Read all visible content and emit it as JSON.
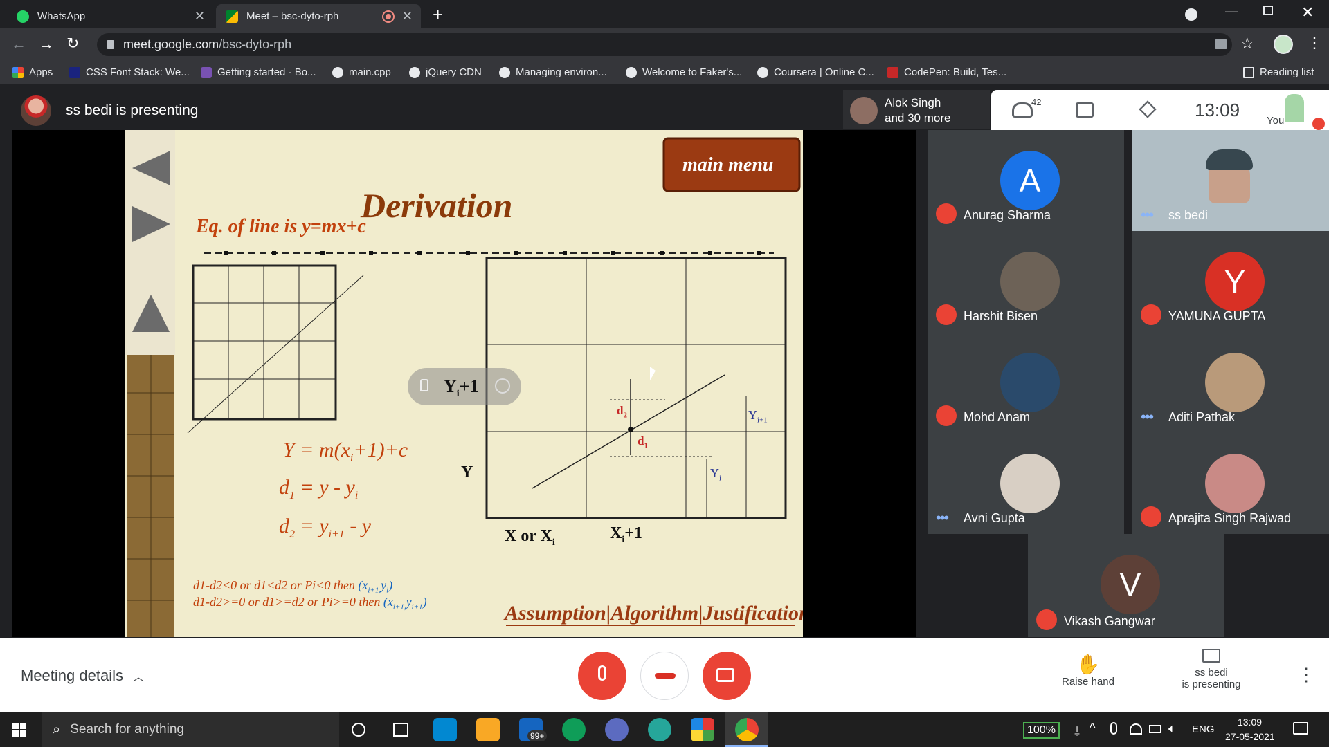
{
  "browser": {
    "tabs": [
      {
        "title": "WhatsApp",
        "active": false,
        "icon": "whatsapp-icon"
      },
      {
        "title": "Meet – bsc-dyto-rph",
        "active": true,
        "icon": "meet-icon",
        "recording": true
      }
    ],
    "url_host": "meet.google.com",
    "url_path": "/bsc-dyto-rph",
    "bookmarks": [
      {
        "label": "Apps",
        "icon": "apps-grid-icon"
      },
      {
        "label": "CSS Font Stack: We...",
        "icon": "cssfont-icon"
      },
      {
        "label": "Getting started · Bo...",
        "icon": "bootstrap-icon"
      },
      {
        "label": "main.cpp",
        "icon": "globe-icon"
      },
      {
        "label": "jQuery CDN",
        "icon": "globe-icon"
      },
      {
        "label": "Managing environ...",
        "icon": "globe-icon"
      },
      {
        "label": "Welcome to Faker's...",
        "icon": "globe-icon"
      },
      {
        "label": "Coursera | Online C...",
        "icon": "globe-icon"
      },
      {
        "label": "CodePen: Build, Tes...",
        "icon": "codepen-icon"
      }
    ],
    "reading_list": "Reading list"
  },
  "meet": {
    "presenter_banner": "ss bedi is presenting",
    "others_name": "Alok Singh",
    "others_more": "and 30 more",
    "participant_count": "42",
    "clock": "13:09",
    "you_label": "You",
    "participants": [
      {
        "name": "Anurag Sharma",
        "initial": "A",
        "color": "#1a73e8",
        "muted": true
      },
      {
        "name": "ss bedi",
        "initial": "",
        "color": "#9aa3ad",
        "muted": false,
        "video": true
      },
      {
        "name": "Harshit Bisen",
        "initial": "",
        "color": "#6d6257",
        "muted": true
      },
      {
        "name": "YAMUNA GUPTA",
        "initial": "Y",
        "color": "#d93025",
        "muted": true
      },
      {
        "name": "Mohd Anam",
        "initial": "",
        "color": "#2a4a6b",
        "muted": true
      },
      {
        "name": "Aditi Pathak",
        "initial": "",
        "color": "#b99a7a",
        "muted": false
      },
      {
        "name": "Avni Gupta",
        "initial": "",
        "color": "#d8cfc4",
        "muted": false
      },
      {
        "name": "Aprajita Singh Rajwad",
        "initial": "",
        "color": "#c98a86",
        "muted": true
      },
      {
        "name": "Vikash Gangwar",
        "initial": "V",
        "color": "#5d4037",
        "muted": true
      }
    ],
    "meeting_details": "Meeting details",
    "raise_hand": "Raise hand",
    "presenting_line1": "ss bedi",
    "presenting_line2": "is presenting"
  },
  "slide": {
    "title": "Derivation",
    "menu_label": "main menu",
    "equation": "Eq. of line is y=mx+c",
    "formula1_main": "Y = m(x",
    "formula1_sub": "i",
    "formula1_tail": "+1)+c",
    "formula2_main": "d",
    "formula2_sub": "1",
    "formula2_tail": " = y - y",
    "formula2_sub2": "i",
    "formula3_main": "d",
    "formula3_sub": "2",
    "formula3_tail": " = y",
    "formula3_sub2": "i+1",
    "formula3_end": " - y",
    "y_label": "Y",
    "x_label_a": "X or X",
    "x_label_a_sub": "i",
    "x_label_b": "X",
    "x_label_b_sub": "i",
    "x_label_b_tail": "+1",
    "d1": "d",
    "d1_sub": "1",
    "d2": "d",
    "d2_sub": "2",
    "yi": "Y",
    "yi_sub": "i",
    "yi1": "Y",
    "yi1_sub": "i+1",
    "popup_label": "Y",
    "popup_sub": "i",
    "popup_tail": "+1",
    "rule1_text": "d1-d2<0 or d1<d2 or Pi<0 then",
    "rule1_point": "(x",
    "rule1_point_sub": "i+1,",
    "rule1_point_tail": "y",
    "rule1_point_sub2": "i",
    "rule1_point_end": ")",
    "rule2_text": "d1-d2>=0 or d1>=d2 or Pi>=0 then",
    "rule2_point": "(x",
    "rule2_point_sub": "i+1,",
    "rule2_point_tail": "y",
    "rule2_point_sub2": "i+1",
    "rule2_point_end": ")",
    "links": "Assumption|Algorithm|Justification"
  },
  "taskbar": {
    "search_placeholder": "Search for anything",
    "mail_badge": "99+",
    "battery": "100%",
    "lang": "ENG",
    "time": "13:09",
    "date": "27-05-2021"
  }
}
